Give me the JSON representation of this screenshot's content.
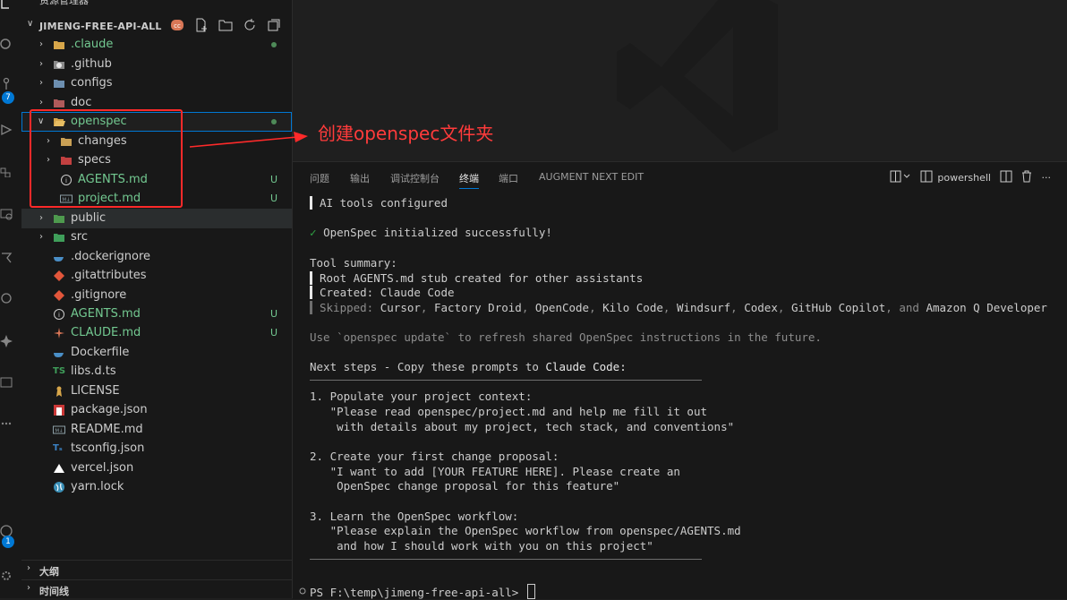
{
  "activity_bar": {
    "source_control_badge": "7",
    "accounts_badge": "1"
  },
  "explorer": {
    "title": "资源管理器",
    "workspace": "JIMENG-FREE-API-ALL",
    "tree": [
      {
        "label": ".claude",
        "status": "dot"
      },
      {
        "label": ".github",
        "status": ""
      },
      {
        "label": "configs",
        "status": ""
      },
      {
        "label": "doc",
        "status": ""
      },
      {
        "label": "openspec",
        "status": "dot"
      },
      {
        "label": "changes",
        "status": ""
      },
      {
        "label": "specs",
        "status": ""
      },
      {
        "label": "AGENTS.md",
        "status": "U"
      },
      {
        "label": "project.md",
        "status": "U"
      },
      {
        "label": "public",
        "status": ""
      },
      {
        "label": "src",
        "status": ""
      },
      {
        "label": ".dockerignore",
        "status": ""
      },
      {
        "label": ".gitattributes",
        "status": ""
      },
      {
        "label": ".gitignore",
        "status": ""
      },
      {
        "label": "AGENTS.md",
        "status": "U"
      },
      {
        "label": "CLAUDE.md",
        "status": "U"
      },
      {
        "label": "Dockerfile",
        "status": ""
      },
      {
        "label": "libs.d.ts",
        "status": ""
      },
      {
        "label": "LICENSE",
        "status": ""
      },
      {
        "label": "package.json",
        "status": ""
      },
      {
        "label": "README.md",
        "status": ""
      },
      {
        "label": "tsconfig.json",
        "status": ""
      },
      {
        "label": "vercel.json",
        "status": ""
      },
      {
        "label": "yarn.lock",
        "status": ""
      }
    ],
    "outline": "大纲",
    "timeline": "时间线"
  },
  "annotation": {
    "text": "创建openspec文件夹",
    "color": "#ff3b3b"
  },
  "panel": {
    "tabs": [
      "问题",
      "输出",
      "调试控制台",
      "终端",
      "端口",
      "AUGMENT NEXT EDIT"
    ],
    "active_tab": "终端",
    "shell": "powershell"
  },
  "terminal": {
    "l1": "AI tools configured",
    "l2_check": "✓",
    "l2": "OpenSpec initialized successfully!",
    "summary_title": "Tool summary:",
    "s1": "Root AGENTS.md stub created for other assistants",
    "s2": "Created: Claude Code",
    "skipped_label": "Skipped:",
    "skipped_tools": [
      "Cursor",
      "Factory Droid",
      "OpenCode",
      "Kilo Code",
      "Windsurf",
      "Codex",
      "GitHub Copilot"
    ],
    "skipped_and": "and",
    "skipped_last": "Amazon Q Developer",
    "update_hint": "Use `openspec update` to refresh shared OpenSpec instructions in the future.",
    "next_steps_prefix": "Next steps - Copy these prompts to",
    "next_steps_target": "Claude Code:",
    "step1_title": "1. Populate your project context:",
    "step1_a": "   \"Please read openspec/project.md and help me fill it out",
    "step1_b": "    with details about my project, tech stack, and conventions\"",
    "step2_title": "2. Create your first change proposal:",
    "step2_a": "   \"I want to add [YOUR FEATURE HERE]. Please create an",
    "step2_b": "    OpenSpec change proposal for this feature\"",
    "step3_title": "3. Learn the OpenSpec workflow:",
    "step3_a": "   \"Please explain the OpenSpec workflow from openspec/AGENTS.md",
    "step3_b": "    and how I should work with you on this project\"",
    "prompt": "PS F:\\temp\\jimeng-free-api-all> "
  }
}
